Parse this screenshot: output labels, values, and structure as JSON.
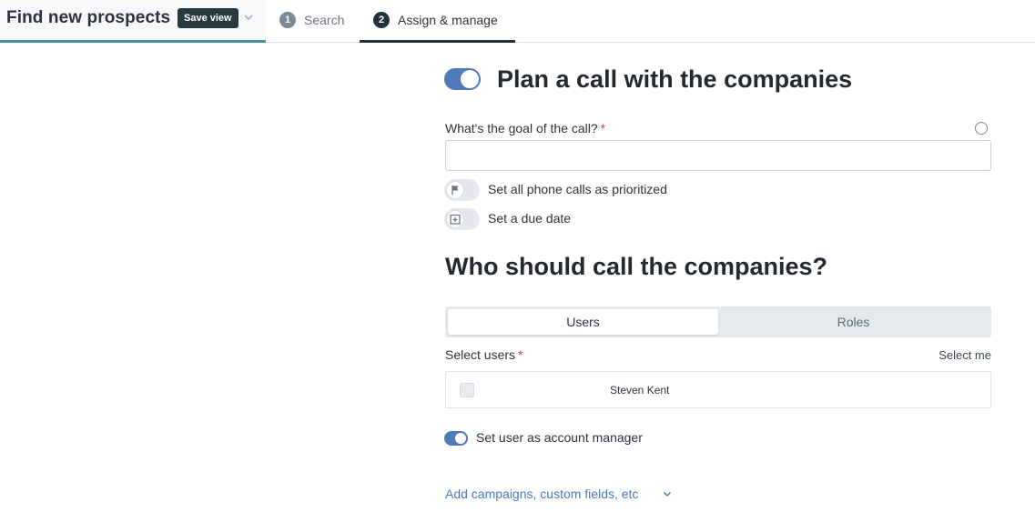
{
  "header": {
    "title": "Find new prospects",
    "save_view_label": "Save view",
    "steps": [
      {
        "number": "1",
        "label": "Search",
        "active": false
      },
      {
        "number": "2",
        "label": "Assign & manage",
        "active": true
      }
    ]
  },
  "plan_call": {
    "title": "Plan a call with the companies",
    "enabled": true,
    "goal_label": "What's the goal of the call?",
    "goal_required_mark": "*",
    "goal_value": "",
    "options": [
      {
        "label": "Set all phone calls as prioritized",
        "icon": "flag-icon",
        "enabled": false
      },
      {
        "label": "Set a due date",
        "icon": "calendar-icon",
        "enabled": false
      }
    ]
  },
  "who": {
    "title": "Who should call the companies?",
    "tabs": [
      "Users",
      "Roles"
    ],
    "active_tab": "Users",
    "select_label": "Select users",
    "select_required_mark": "*",
    "select_me_label": "Select me",
    "users": [
      {
        "name": "Steven Kent",
        "checked": false
      }
    ],
    "account_manager_label": "Set user as account manager",
    "account_manager_enabled": true
  },
  "more_link": "Add campaigns, custom fields, etc",
  "colors": {
    "accent_blue": "#4f79b8",
    "dark_navy": "#22323a",
    "teal_underline": "#4a8f9c",
    "required_red": "#d04040"
  }
}
